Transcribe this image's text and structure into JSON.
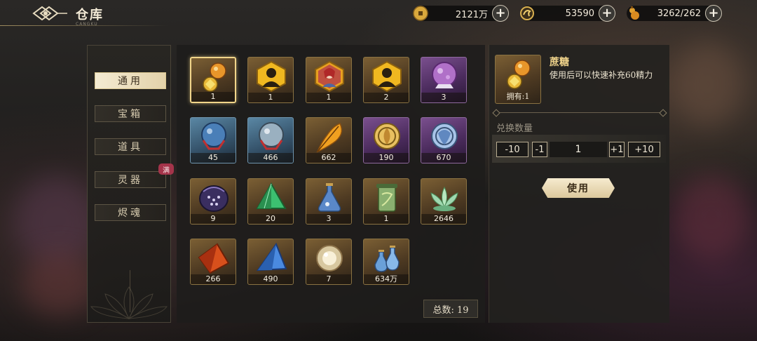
{
  "header": {
    "title": "仓库",
    "subtitle": "CANGKU"
  },
  "resources": [
    {
      "name": "coin",
      "icon": "gold-coin-icon",
      "value": "2121万"
    },
    {
      "name": "dragon-token",
      "icon": "dragon-token-icon",
      "value": "53590"
    },
    {
      "name": "stamina",
      "icon": "gourd-icon",
      "value": "3262/262"
    }
  ],
  "nav": {
    "items": [
      {
        "label": "通用",
        "active": true
      },
      {
        "label": "宝箱",
        "active": false
      },
      {
        "label": "道具",
        "active": false
      },
      {
        "label": "灵器",
        "active": false,
        "badge": "满"
      },
      {
        "label": "烬魂",
        "active": false
      }
    ]
  },
  "items": [
    {
      "icon": "candy-gourd-icon",
      "count": "1",
      "selected": true,
      "color": "gold"
    },
    {
      "icon": "hexagon-silhouette-icon",
      "count": "1",
      "color": "gold"
    },
    {
      "icon": "character-portrait-icon",
      "count": "1",
      "color": "gold"
    },
    {
      "icon": "hexagon-silhouette-icon",
      "count": "2",
      "color": "gold"
    },
    {
      "icon": "purple-crystal-ball-icon",
      "count": "3",
      "color": "purple"
    },
    {
      "icon": "blue-crystal-ball-icon",
      "count": "45",
      "color": "blue"
    },
    {
      "icon": "silver-crystal-ball-icon",
      "count": "466",
      "color": "blue"
    },
    {
      "icon": "golden-feather-icon",
      "count": "662",
      "color": "gold"
    },
    {
      "icon": "purple-gold-medallion-icon",
      "count": "190",
      "color": "purple"
    },
    {
      "icon": "blue-silver-medallion-icon",
      "count": "670",
      "color": "purple"
    },
    {
      "icon": "dark-orb-icon",
      "count": "9",
      "color": "gold"
    },
    {
      "icon": "green-crystal-icon",
      "count": "20",
      "color": "gold"
    },
    {
      "icon": "blue-flask-icon",
      "count": "3",
      "color": "gold"
    },
    {
      "icon": "green-scroll-icon",
      "count": "1",
      "color": "gold"
    },
    {
      "icon": "jade-lotus-icon",
      "count": "2646",
      "color": "gold"
    },
    {
      "icon": "red-crystal-icon",
      "count": "266",
      "color": "gold"
    },
    {
      "icon": "blue-crystal-icon",
      "count": "490",
      "color": "gold"
    },
    {
      "icon": "glowing-orb-icon",
      "count": "7",
      "color": "gold"
    },
    {
      "icon": "potion-bottles-icon",
      "count": "634万",
      "color": "gold"
    }
  ],
  "total": "总数: 19",
  "detail": {
    "name": "蔗糖",
    "description": "使用后可以快速补充60精力",
    "owned": "拥有:1",
    "exchange_label": "兑换数量",
    "minus10": "-10",
    "minus1": "-1",
    "quantity": "1",
    "plus1": "+1",
    "plus10": "+10",
    "use_label": "使用"
  },
  "colors": {
    "accent_gold": "#f2d58c",
    "badge_red": "#a4344a",
    "nav_active": "#f4ebd2"
  }
}
